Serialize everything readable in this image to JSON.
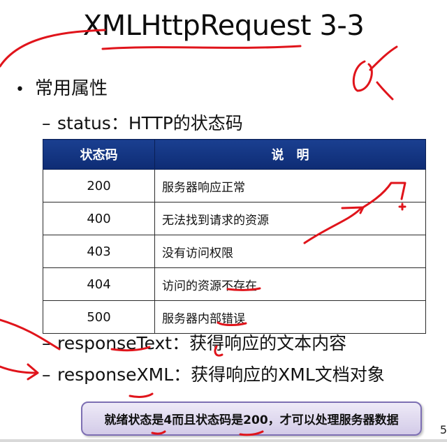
{
  "slide": {
    "title": "XMLHttpRequest 3-3",
    "bullet": "常用属性",
    "status_item": "status：HTTP的状态码",
    "table": {
      "headers": [
        "状态码",
        "说　明"
      ],
      "rows": [
        {
          "code": "200",
          "desc": "服务器响应正常"
        },
        {
          "code": "400",
          "desc": "无法找到请求的资源"
        },
        {
          "code": "403",
          "desc": "没有访问权限"
        },
        {
          "code": "404",
          "desc": "访问的资源不存在"
        },
        {
          "code": "500",
          "desc": "服务器内部错误"
        }
      ]
    },
    "response_text_item": "responseText：获得响应的文本内容",
    "response_xml_item": "responseXML：获得响应的XML文档对象",
    "callout": "就绪状态是4而且状态码是200，才可以处理服务器数据",
    "page_number": "5",
    "annotation_color": "#e0141b",
    "header_color": "#1a3f90"
  }
}
